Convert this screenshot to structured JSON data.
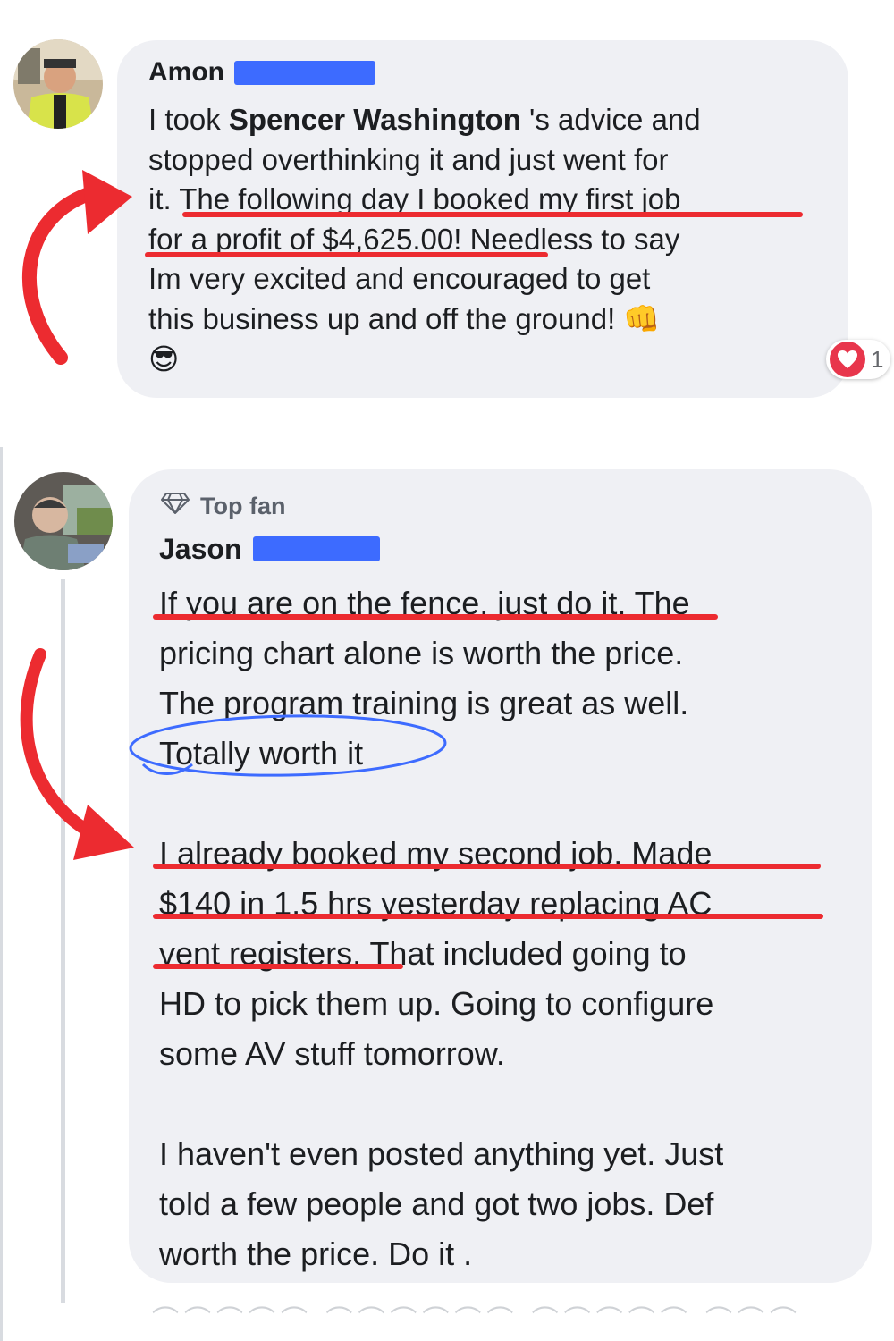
{
  "comment1": {
    "author": "Amon",
    "lines": [
      {
        "parts": [
          {
            "t": "I took "
          },
          {
            "t": "Spencer Washington",
            "b": true
          },
          {
            "t": " 's advice and"
          }
        ]
      },
      {
        "parts": [
          {
            "t": "stopped overthinking it and just went for"
          }
        ]
      },
      {
        "parts": [
          {
            "t": "it. The following day I booked my first job"
          }
        ]
      },
      {
        "parts": [
          {
            "t": "for a profit of $4,625.00! Needless to say"
          }
        ]
      },
      {
        "parts": [
          {
            "t": "Im very excited and encouraged to get"
          }
        ]
      },
      {
        "parts": [
          {
            "t": "this business up and off the ground! 👊"
          }
        ]
      },
      {
        "parts": [
          {
            "t": "😎"
          }
        ]
      }
    ],
    "reaction": {
      "icon": "heart-icon",
      "count": "1"
    }
  },
  "comment2": {
    "badge": "Top fan",
    "author": "Jason",
    "lines": [
      "If you are on the fence, just do it.  The",
      "pricing chart alone is worth the price.",
      "The program training is great as well.",
      "Totally worth it",
      "",
      "I already booked my second job.  Made",
      "$140 in 1.5 hrs yesterday replacing AC",
      "vent registers.  That included going to",
      "HD to pick them up.  Going to configure",
      "some AV stuff tomorrow.",
      "",
      "I haven't even posted anything yet.  Just",
      "told a few people and got two jobs.  Def",
      "worth the price.  Do it ."
    ]
  },
  "colors": {
    "bubble": "#eff0f4",
    "annotation_red": "#ec2b30",
    "annotation_blue": "#3d6bff",
    "redaction": "#3d6bff"
  }
}
